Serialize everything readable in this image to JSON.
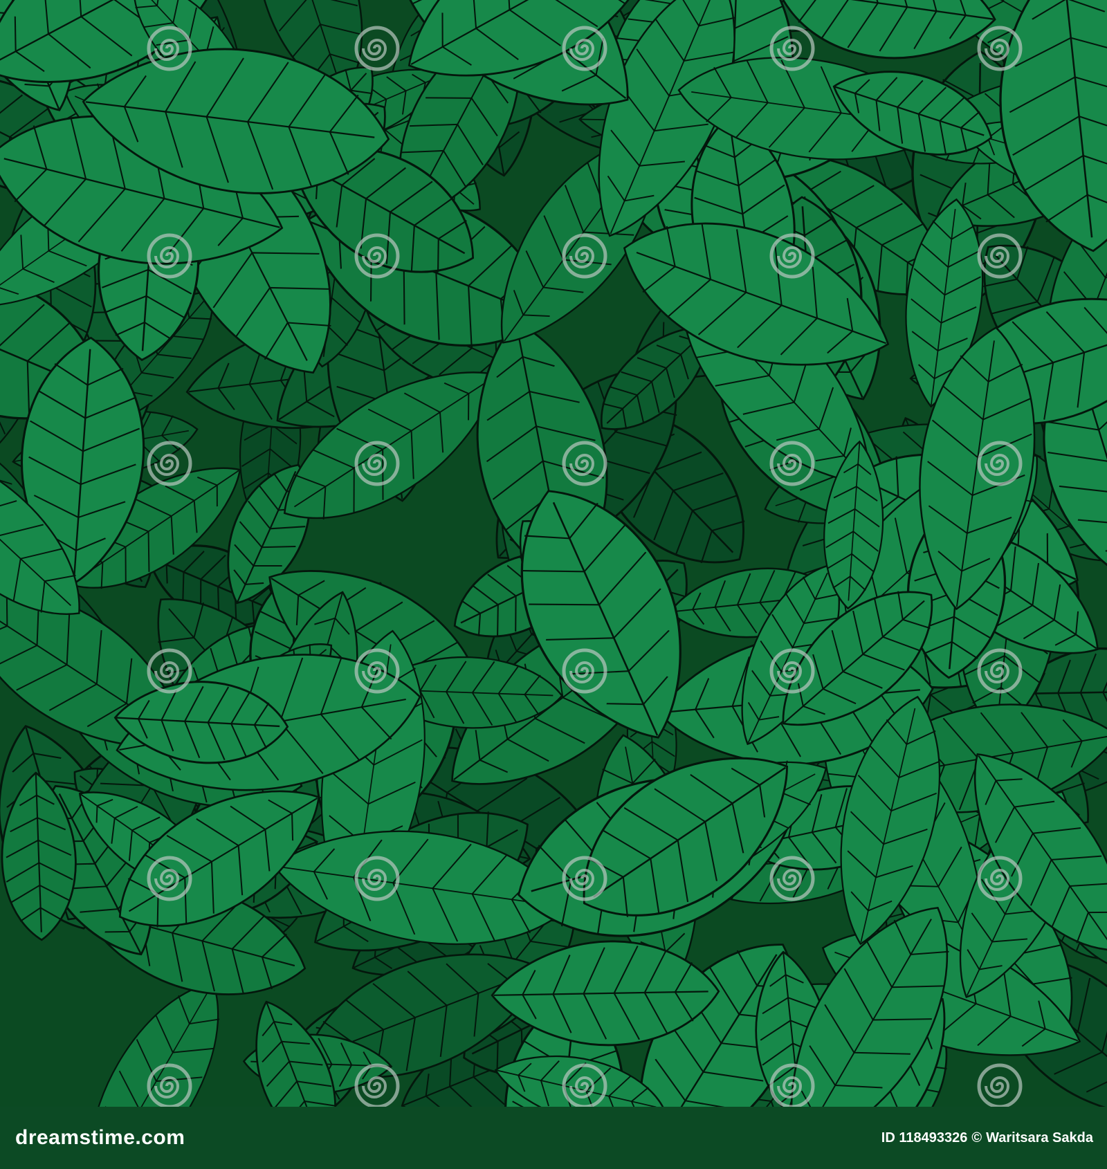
{
  "colors": {
    "background": "#0b4a22",
    "leaf_light": "#17894a",
    "leaf_mid": "#127a3f",
    "leaf_dark": "#0c5c2e",
    "leaf_deep": "#094a25",
    "outline": "#04170c",
    "footer": "#0c4a24",
    "watermark": "#b9c7c0"
  },
  "watermark": {
    "icon": "spiral-icon",
    "text": "dreamstime"
  },
  "footer": {
    "logo": "dreamstime.com",
    "image_id": "ID 118493326",
    "copyright_symbol": "©",
    "author": "Waritsara Sakda"
  }
}
